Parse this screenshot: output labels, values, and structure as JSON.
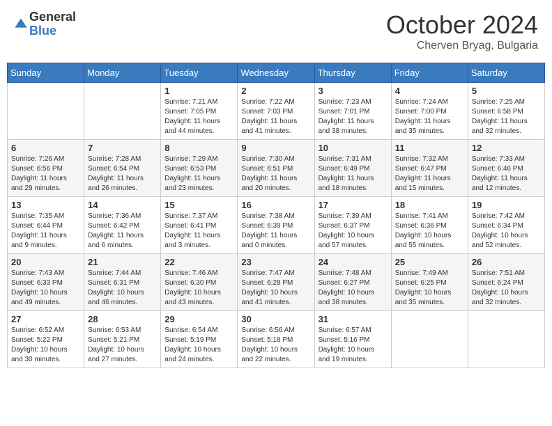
{
  "header": {
    "logo_line1": "General",
    "logo_line2": "Blue",
    "month": "October 2024",
    "location": "Cherven Bryag, Bulgaria"
  },
  "days_of_week": [
    "Sunday",
    "Monday",
    "Tuesday",
    "Wednesday",
    "Thursday",
    "Friday",
    "Saturday"
  ],
  "weeks": [
    [
      {
        "day": "",
        "info": ""
      },
      {
        "day": "",
        "info": ""
      },
      {
        "day": "1",
        "info": "Sunrise: 7:21 AM\nSunset: 7:05 PM\nDaylight: 11 hours and 44 minutes."
      },
      {
        "day": "2",
        "info": "Sunrise: 7:22 AM\nSunset: 7:03 PM\nDaylight: 11 hours and 41 minutes."
      },
      {
        "day": "3",
        "info": "Sunrise: 7:23 AM\nSunset: 7:01 PM\nDaylight: 11 hours and 38 minutes."
      },
      {
        "day": "4",
        "info": "Sunrise: 7:24 AM\nSunset: 7:00 PM\nDaylight: 11 hours and 35 minutes."
      },
      {
        "day": "5",
        "info": "Sunrise: 7:25 AM\nSunset: 6:58 PM\nDaylight: 11 hours and 32 minutes."
      }
    ],
    [
      {
        "day": "6",
        "info": "Sunrise: 7:26 AM\nSunset: 6:56 PM\nDaylight: 11 hours and 29 minutes."
      },
      {
        "day": "7",
        "info": "Sunrise: 7:28 AM\nSunset: 6:54 PM\nDaylight: 11 hours and 26 minutes."
      },
      {
        "day": "8",
        "info": "Sunrise: 7:29 AM\nSunset: 6:53 PM\nDaylight: 11 hours and 23 minutes."
      },
      {
        "day": "9",
        "info": "Sunrise: 7:30 AM\nSunset: 6:51 PM\nDaylight: 11 hours and 20 minutes."
      },
      {
        "day": "10",
        "info": "Sunrise: 7:31 AM\nSunset: 6:49 PM\nDaylight: 11 hours and 18 minutes."
      },
      {
        "day": "11",
        "info": "Sunrise: 7:32 AM\nSunset: 6:47 PM\nDaylight: 11 hours and 15 minutes."
      },
      {
        "day": "12",
        "info": "Sunrise: 7:33 AM\nSunset: 6:46 PM\nDaylight: 11 hours and 12 minutes."
      }
    ],
    [
      {
        "day": "13",
        "info": "Sunrise: 7:35 AM\nSunset: 6:44 PM\nDaylight: 11 hours and 9 minutes."
      },
      {
        "day": "14",
        "info": "Sunrise: 7:36 AM\nSunset: 6:42 PM\nDaylight: 11 hours and 6 minutes."
      },
      {
        "day": "15",
        "info": "Sunrise: 7:37 AM\nSunset: 6:41 PM\nDaylight: 11 hours and 3 minutes."
      },
      {
        "day": "16",
        "info": "Sunrise: 7:38 AM\nSunset: 6:39 PM\nDaylight: 11 hours and 0 minutes."
      },
      {
        "day": "17",
        "info": "Sunrise: 7:39 AM\nSunset: 6:37 PM\nDaylight: 10 hours and 57 minutes."
      },
      {
        "day": "18",
        "info": "Sunrise: 7:41 AM\nSunset: 6:36 PM\nDaylight: 10 hours and 55 minutes."
      },
      {
        "day": "19",
        "info": "Sunrise: 7:42 AM\nSunset: 6:34 PM\nDaylight: 10 hours and 52 minutes."
      }
    ],
    [
      {
        "day": "20",
        "info": "Sunrise: 7:43 AM\nSunset: 6:33 PM\nDaylight: 10 hours and 49 minutes."
      },
      {
        "day": "21",
        "info": "Sunrise: 7:44 AM\nSunset: 6:31 PM\nDaylight: 10 hours and 46 minutes."
      },
      {
        "day": "22",
        "info": "Sunrise: 7:46 AM\nSunset: 6:30 PM\nDaylight: 10 hours and 43 minutes."
      },
      {
        "day": "23",
        "info": "Sunrise: 7:47 AM\nSunset: 6:28 PM\nDaylight: 10 hours and 41 minutes."
      },
      {
        "day": "24",
        "info": "Sunrise: 7:48 AM\nSunset: 6:27 PM\nDaylight: 10 hours and 38 minutes."
      },
      {
        "day": "25",
        "info": "Sunrise: 7:49 AM\nSunset: 6:25 PM\nDaylight: 10 hours and 35 minutes."
      },
      {
        "day": "26",
        "info": "Sunrise: 7:51 AM\nSunset: 6:24 PM\nDaylight: 10 hours and 32 minutes."
      }
    ],
    [
      {
        "day": "27",
        "info": "Sunrise: 6:52 AM\nSunset: 5:22 PM\nDaylight: 10 hours and 30 minutes."
      },
      {
        "day": "28",
        "info": "Sunrise: 6:53 AM\nSunset: 5:21 PM\nDaylight: 10 hours and 27 minutes."
      },
      {
        "day": "29",
        "info": "Sunrise: 6:54 AM\nSunset: 5:19 PM\nDaylight: 10 hours and 24 minutes."
      },
      {
        "day": "30",
        "info": "Sunrise: 6:56 AM\nSunset: 5:18 PM\nDaylight: 10 hours and 22 minutes."
      },
      {
        "day": "31",
        "info": "Sunrise: 6:57 AM\nSunset: 5:16 PM\nDaylight: 10 hours and 19 minutes."
      },
      {
        "day": "",
        "info": ""
      },
      {
        "day": "",
        "info": ""
      }
    ]
  ]
}
